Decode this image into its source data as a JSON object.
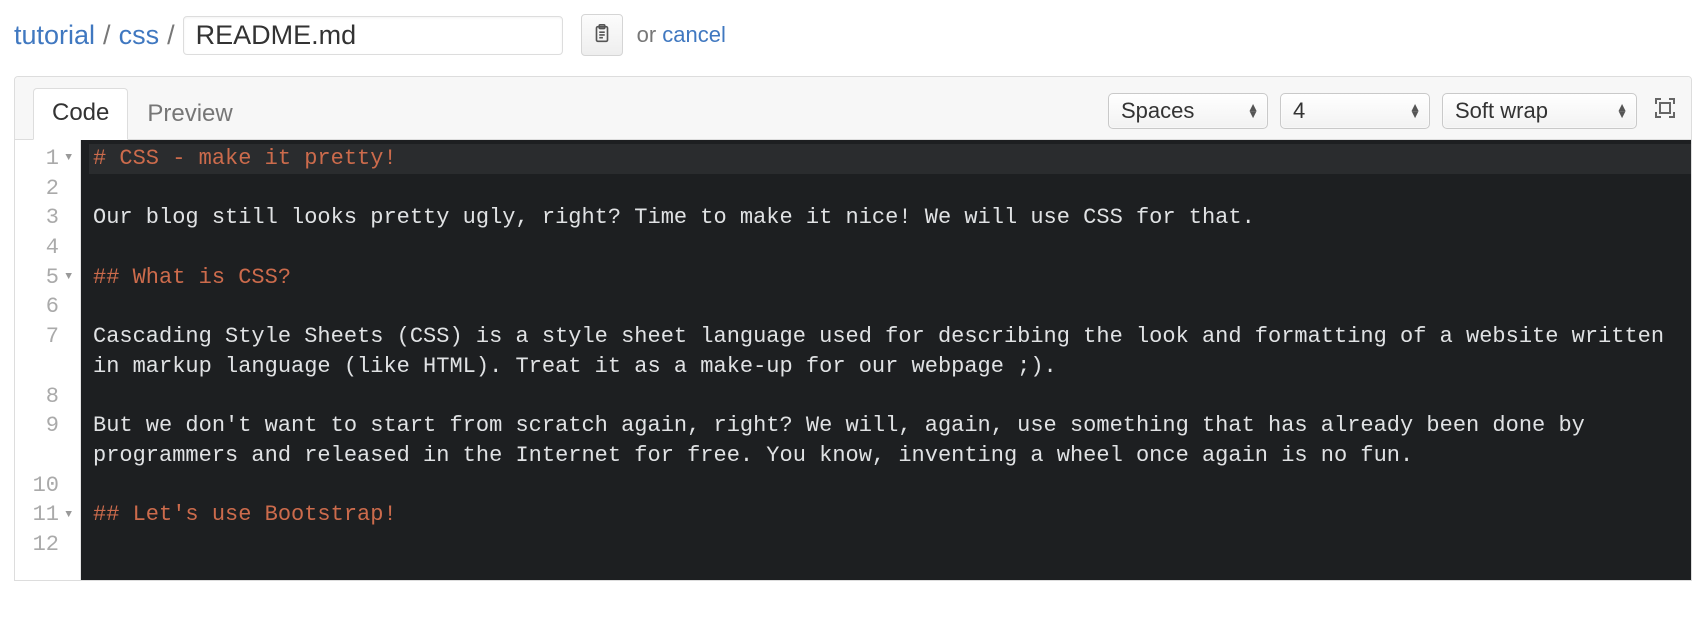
{
  "breadcrumb": {
    "root": "tutorial",
    "folder": "css",
    "separator": "/",
    "filename": "README.md"
  },
  "actions": {
    "or": "or",
    "cancel": "cancel"
  },
  "tabs": {
    "code": "Code",
    "preview": "Preview"
  },
  "controls": {
    "indent_mode": "Spaces",
    "indent_size": "4",
    "wrap_mode": "Soft wrap"
  },
  "editor": {
    "lines": [
      {
        "n": 1,
        "foldable": true,
        "highlight": true,
        "type": "heading",
        "text": "# CSS - make it pretty!"
      },
      {
        "n": 2,
        "foldable": false,
        "highlight": false,
        "type": "blank",
        "text": ""
      },
      {
        "n": 3,
        "foldable": false,
        "highlight": false,
        "type": "text",
        "text": "Our blog still looks pretty ugly, right? Time to make it nice! We will use CSS for that."
      },
      {
        "n": 4,
        "foldable": false,
        "highlight": false,
        "type": "blank",
        "text": ""
      },
      {
        "n": 5,
        "foldable": true,
        "highlight": false,
        "type": "heading",
        "text": "## What is CSS?"
      },
      {
        "n": 6,
        "foldable": false,
        "highlight": false,
        "type": "blank",
        "text": ""
      },
      {
        "n": 7,
        "foldable": false,
        "highlight": false,
        "type": "text",
        "text": "Cascading Style Sheets (CSS) is a style sheet language used for describing the look and formatting of a website written",
        "wrap": "in markup language (like HTML). Treat it as a make-up for our webpage ;)."
      },
      {
        "n": 8,
        "foldable": false,
        "highlight": false,
        "type": "blank",
        "text": ""
      },
      {
        "n": 9,
        "foldable": false,
        "highlight": false,
        "type": "text",
        "text": "But we don't want to start from scratch again, right? We will, again, use something that has already been done by",
        "wrap": "programmers and released in the Internet for free. You know, inventing a wheel once again is no fun."
      },
      {
        "n": 10,
        "foldable": false,
        "highlight": false,
        "type": "blank",
        "text": ""
      },
      {
        "n": 11,
        "foldable": true,
        "highlight": false,
        "type": "heading",
        "text": "## Let's use Bootstrap!"
      },
      {
        "n": 12,
        "foldable": false,
        "highlight": false,
        "type": "blank",
        "text": ""
      }
    ]
  }
}
